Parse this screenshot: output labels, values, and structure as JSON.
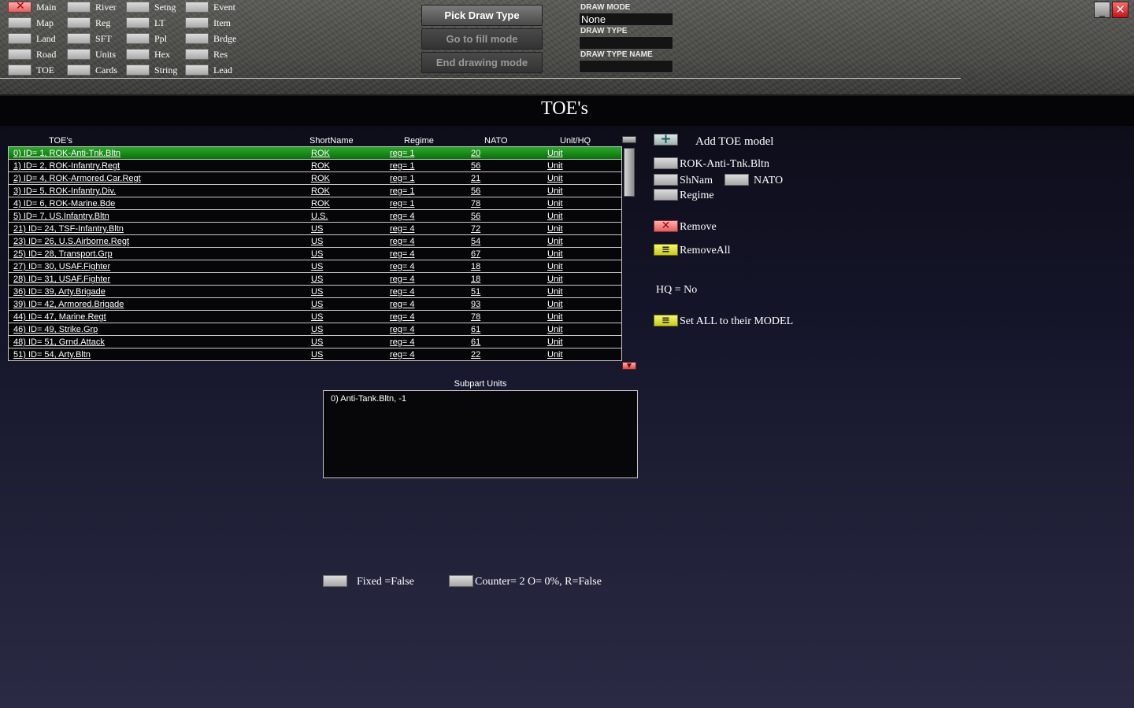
{
  "nav": {
    "columns": [
      [
        {
          "label": "Main",
          "active": true
        },
        {
          "label": "Map"
        },
        {
          "label": "Land"
        },
        {
          "label": "Road"
        },
        {
          "label": "TOE"
        }
      ],
      [
        {
          "label": "River"
        },
        {
          "label": "Reg"
        },
        {
          "label": "SFT"
        },
        {
          "label": "Units"
        },
        {
          "label": "Cards"
        }
      ],
      [
        {
          "label": "Setng"
        },
        {
          "label": "LT"
        },
        {
          "label": "Ppl"
        },
        {
          "label": "Hex"
        },
        {
          "label": "String"
        }
      ],
      [
        {
          "label": "Event"
        },
        {
          "label": "Item"
        },
        {
          "label": "Brdge"
        },
        {
          "label": "Res"
        },
        {
          "label": "Lead"
        }
      ]
    ]
  },
  "toolbar": {
    "pick_draw_type": "Pick Draw Type",
    "go_fill_mode": "Go to fill mode",
    "end_drawing_mode": "End drawing mode"
  },
  "draw": {
    "mode_label": "DRAW MODE",
    "mode_value": "None",
    "type_label": "DRAW TYPE",
    "type_value": "",
    "type_name_label": "DRAW TYPE NAME",
    "type_name_value": ""
  },
  "window": {
    "minimize_icon": "minimize-icon",
    "close_icon": "close-icon"
  },
  "page_title": "TOE's",
  "table": {
    "headers": [
      "TOE's",
      "ShortName",
      "Regime",
      "NATO",
      "Unit/HQ"
    ],
    "selected_index": 0,
    "rows": [
      [
        "0) ID= 1, ROK-Anti-Tnk.Bltn",
        "ROK",
        "reg= 1",
        "20",
        "Unit"
      ],
      [
        "1) ID= 2, ROK-Infantry.Regt",
        "ROK",
        "reg= 1",
        "56",
        "Unit"
      ],
      [
        "2) ID= 4, ROK-Armored.Car.Regt",
        "ROK",
        "reg= 1",
        "21",
        "Unit"
      ],
      [
        "3) ID= 5, ROK-Infantry.Div.",
        "ROK",
        "reg= 1",
        "56",
        "Unit"
      ],
      [
        "4) ID= 6, ROK-Marine.Bde",
        "ROK",
        "reg= 1",
        "78",
        "Unit"
      ],
      [
        "5) ID= 7, US.Infantry.Bltn",
        "U.S.",
        "reg= 4",
        "56",
        "Unit"
      ],
      [
        "21) ID= 24, TSF-Infantry.Bltn",
        "US",
        "reg= 4",
        "72",
        "Unit"
      ],
      [
        "23) ID= 26, U.S.Airborne.Regt",
        "US",
        "reg= 4",
        "54",
        "Unit"
      ],
      [
        "25) ID= 28, Transport.Grp",
        "US",
        "reg= 4",
        "67",
        "Unit"
      ],
      [
        "27) ID= 30, USAF.Fighter",
        "US",
        "reg= 4",
        "18",
        "Unit"
      ],
      [
        "28) ID= 31, USAF.Fighter",
        "US",
        "reg= 4",
        "18",
        "Unit"
      ],
      [
        "36) ID= 39, Arty.Brigade",
        "US",
        "reg= 4",
        "51",
        "Unit"
      ],
      [
        "39) ID= 42, Armored.Brigade",
        "US",
        "reg= 4",
        "93",
        "Unit"
      ],
      [
        "44) ID= 47, Marine.Regt",
        "US",
        "reg= 4",
        "78",
        "Unit"
      ],
      [
        "46) ID= 49, Strike.Grp",
        "US",
        "reg= 4",
        "61",
        "Unit"
      ],
      [
        "48) ID= 51, Grnd.Attack",
        "US",
        "reg= 4",
        "61",
        "Unit"
      ],
      [
        "51) ID= 54, Arty.Bltn",
        "US",
        "reg= 4",
        "22",
        "Unit"
      ]
    ]
  },
  "right_panel": {
    "add_model": "Add TOE model",
    "name": "ROK-Anti-Tnk.Bltn",
    "shortname": "ShNam",
    "nato": "NATO",
    "regime": "Regime",
    "remove": "Remove",
    "remove_all": "RemoveAll",
    "hq": "HQ = No",
    "set_all": "Set ALL to their MODEL"
  },
  "subpart": {
    "title": "Subpart Units",
    "items": [
      "0) Anti-Tank.Bltn, -1"
    ]
  },
  "bottom": {
    "fixed": "Fixed =False",
    "counter": "Counter=  2 O=  0%, R=False"
  },
  "colors": {
    "selected_row": "#1a8c1a",
    "remove_button": "#e06060",
    "yellow_button": "#e0e030"
  }
}
